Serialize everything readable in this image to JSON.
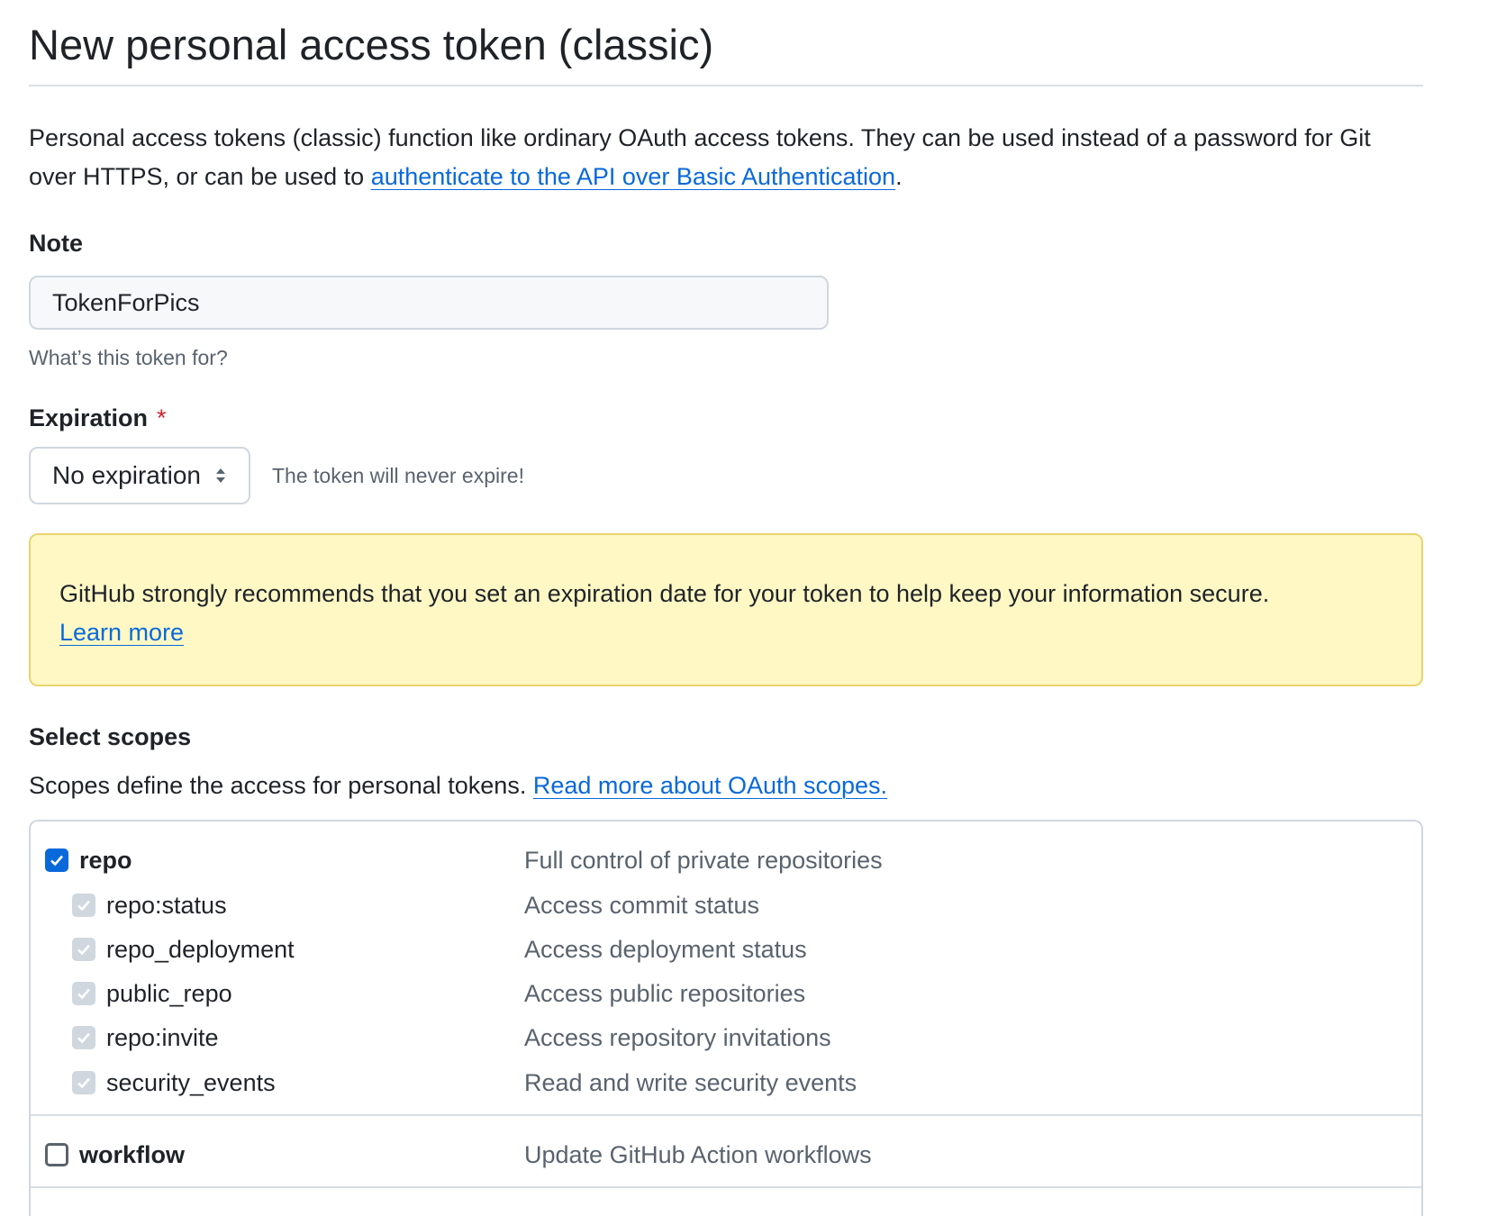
{
  "page": {
    "title": "New personal access token (classic)",
    "intro_text": "Personal access tokens (classic) function like ordinary OAuth access tokens. They can be used instead of a password for Git over HTTPS, or can be used to ",
    "intro_link": "authenticate to the API over Basic Authentication",
    "intro_end": "."
  },
  "note": {
    "label": "Note",
    "value": "TokenForPics",
    "hint": "What’s this token for?"
  },
  "expiration": {
    "label": "Expiration",
    "required_mark": "*",
    "selected": "No expiration",
    "note": "The token will never expire!"
  },
  "warning": {
    "text": "GitHub strongly recommends that you set an expiration date for your token to help keep your information secure.",
    "link": "Learn more"
  },
  "scopes": {
    "title": "Select scopes",
    "desc": "Scopes define the access for personal tokens. ",
    "desc_link": "Read more about OAuth scopes.",
    "items": [
      {
        "name": "repo",
        "desc": "Full control of private repositories",
        "state": "checked"
      },
      {
        "name": "repo:status",
        "desc": "Access commit status",
        "state": "disabled"
      },
      {
        "name": "repo_deployment",
        "desc": "Access deployment status",
        "state": "disabled"
      },
      {
        "name": "public_repo",
        "desc": "Access public repositories",
        "state": "disabled"
      },
      {
        "name": "repo:invite",
        "desc": "Access repository invitations",
        "state": "disabled"
      },
      {
        "name": "security_events",
        "desc": "Read and write security events",
        "state": "disabled"
      },
      {
        "name": "workflow",
        "desc": "Update GitHub Action workflows",
        "state": "unchecked"
      }
    ]
  },
  "colors": {
    "link": "#0969da",
    "warning_bg": "#fff8c5",
    "warning_border": "#e9d36f",
    "checkbox_checked": "#0969da",
    "required": "#d1242f"
  }
}
